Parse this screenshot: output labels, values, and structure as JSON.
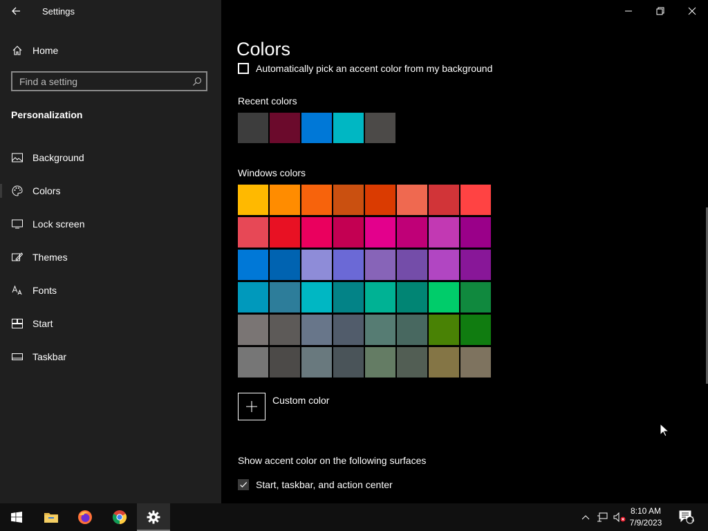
{
  "window": {
    "title": "Settings",
    "minimize_label": "Minimize",
    "maximize_label": "Restore",
    "close_label": "Close"
  },
  "sidebar": {
    "home_label": "Home",
    "search_placeholder": "Find a setting",
    "search_value": "",
    "section_title": "Personalization",
    "items": [
      {
        "label": "Background",
        "icon": "image-icon"
      },
      {
        "label": "Colors",
        "icon": "palette-icon",
        "selected": true
      },
      {
        "label": "Lock screen",
        "icon": "lock-screen-icon"
      },
      {
        "label": "Themes",
        "icon": "themes-icon"
      },
      {
        "label": "Fonts",
        "icon": "fonts-icon"
      },
      {
        "label": "Start",
        "icon": "start-icon"
      },
      {
        "label": "Taskbar",
        "icon": "taskbar-icon"
      }
    ]
  },
  "main": {
    "page_title": "Colors",
    "auto_pick_label": "Automatically pick an accent color from my background",
    "auto_pick_checked": false,
    "recent_colors_label": "Recent colors",
    "recent_colors": [
      "#3d3d3d",
      "#6b0a2c",
      "#0078d7",
      "#00b7c3",
      "#4c4a48"
    ],
    "windows_colors_label": "Windows colors",
    "windows_colors": [
      [
        "#ffb900",
        "#ff8c00",
        "#f7630c",
        "#ca5010",
        "#da3b01",
        "#ef6950",
        "#d13438",
        "#ff4343"
      ],
      [
        "#e74856",
        "#e81123",
        "#ea005e",
        "#c30052",
        "#e3008c",
        "#bf0077",
        "#c239b3",
        "#9a0089"
      ],
      [
        "#0078d7",
        "#0063b1",
        "#8e8cd8",
        "#6b69d6",
        "#8764b8",
        "#744da9",
        "#b146c2",
        "#881798"
      ],
      [
        "#0099bc",
        "#2d7d9a",
        "#00b7c3",
        "#038387",
        "#00b294",
        "#018574",
        "#00cc6a",
        "#10893e"
      ],
      [
        "#7a7574",
        "#5d5a58",
        "#68768a",
        "#515c6b",
        "#567c73",
        "#486860",
        "#498205",
        "#107c10"
      ],
      [
        "#767676",
        "#4c4a48",
        "#69797e",
        "#4a5459",
        "#647c64",
        "#525e54",
        "#847545",
        "#7e735f"
      ]
    ],
    "custom_color_label": "Custom color",
    "surfaces_label": "Show accent color on the following surfaces",
    "surfaces_start_label": "Start, taskbar, and action center",
    "surfaces_start_checked": true
  },
  "taskbar": {
    "apps": [
      {
        "name": "start-button",
        "icon": "windows-logo-icon"
      },
      {
        "name": "file-explorer",
        "icon": "folder-icon"
      },
      {
        "name": "firefox",
        "icon": "firefox-icon"
      },
      {
        "name": "chrome",
        "icon": "chrome-icon"
      },
      {
        "name": "settings",
        "icon": "gear-icon",
        "active": true
      }
    ],
    "time": "8:10 AM",
    "date": "7/9/2023",
    "notification_count": "1"
  }
}
